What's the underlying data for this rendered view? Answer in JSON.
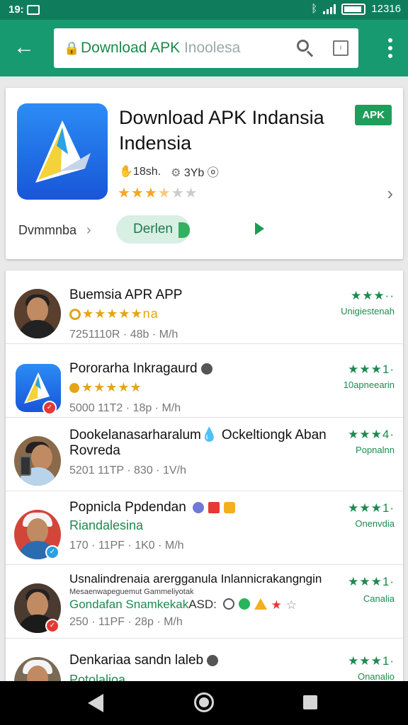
{
  "status_bar": {
    "time": "19:",
    "time_icon": "photo-icon",
    "clock": "12316"
  },
  "app_bar": {
    "url_prefix": "Download APK ",
    "url_suffix": "Inoolesa"
  },
  "hero": {
    "title": "Download APK Indansia Indensia",
    "badge": "APK",
    "meta_1": "18sh.",
    "meta_2": "3Yb",
    "stars_filled": "★★★",
    "stars_half": "★",
    "stars_empty": "★★",
    "rating_value": 3.5,
    "link_label": "Dvmmnba",
    "open_label": "Derlen"
  },
  "list": [
    {
      "title": "Buemsia APR APP",
      "sub": "★★★★★na",
      "sub_style": "gold",
      "meta": "7251110R · 48b · M/h",
      "rating_stars": "★★★··",
      "rating_label": "Unigiestenah",
      "avatar": "person"
    },
    {
      "title": "Pororarha Inkragaurd",
      "sub": "★★★★★",
      "sub_style": "gold",
      "meta": "5000 11T2 · 18p · M/h",
      "rating_stars": "★★★1·",
      "rating_label": "10apneearin",
      "avatar": "app"
    },
    {
      "title": "Dookelanasarharalum",
      "title_suffix": "Ockeltiongk Aban",
      "title_line2": "Rovreda",
      "meta": "5201 11TP · 830 · 1V/h",
      "rating_stars": "★★★4·",
      "rating_label": "Popnalnn",
      "avatar": "person-phone"
    },
    {
      "title": "Popnicla Ppdendan",
      "sub": "Riandalesina",
      "sub_style": "green",
      "meta": "170 · 11PF · 1K0 · M/h",
      "rating_stars": "★★★1·",
      "rating_label": "Onenvdia",
      "avatar": "helmet"
    },
    {
      "title": "Usnalindrenaia arergganula Inlannicrakangngin",
      "small_line": "Mesaenwapeguemut Gammeliyotak",
      "sub": "Gondafan Snamkekak",
      "sub_tail": "ASD:",
      "sub_style": "green",
      "meta": "250 · 11PF · 28p · M/h",
      "rating_stars": "★★★1·",
      "rating_label": "Canalia",
      "avatar": "person"
    },
    {
      "title": "Denkariaa sandn laleb",
      "sub": "Potolalioa",
      "sub_style": "green",
      "meta": "",
      "rating_stars": "★★★1·",
      "rating_label": "Onanalio",
      "avatar": "helmet"
    }
  ]
}
